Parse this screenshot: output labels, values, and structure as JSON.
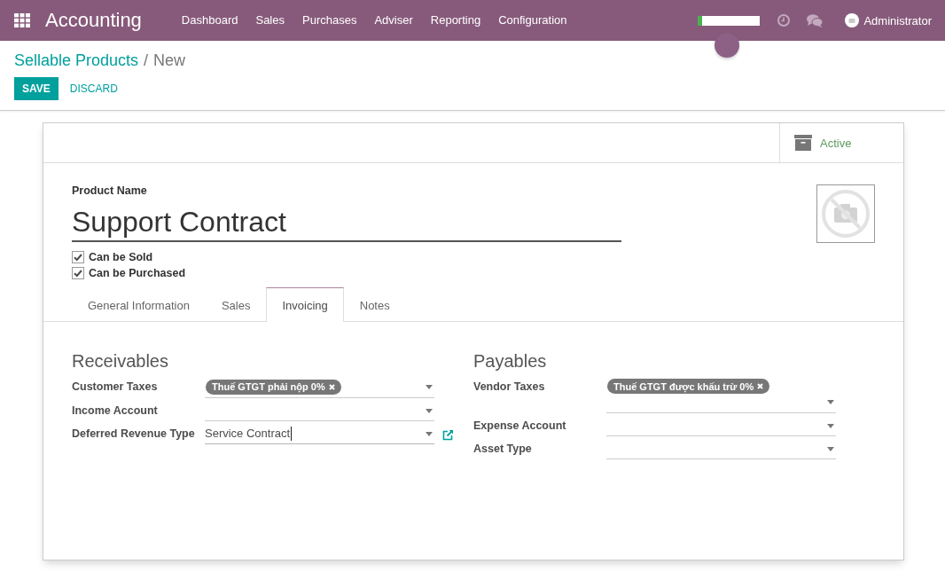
{
  "navbar": {
    "app_title": "Accounting",
    "menu": [
      "Dashboard",
      "Sales",
      "Purchases",
      "Adviser",
      "Reporting",
      "Configuration"
    ],
    "progress": {
      "level": 0.07
    },
    "user": "Administrator"
  },
  "control_panel": {
    "breadcrumb": [
      {
        "label": "Sellable Products",
        "kind": "link"
      },
      {
        "label": "New",
        "kind": "current"
      }
    ],
    "separator": "/",
    "buttons": [
      {
        "label": "SAVE",
        "kind": "primary"
      },
      {
        "label": "DISCARD",
        "kind": "link"
      }
    ]
  },
  "button_box": {
    "label": "Active",
    "on": true
  },
  "product": {
    "name_label": "Product Name",
    "name": "Support Contract",
    "options": [
      {
        "label": "Can be Sold",
        "checked": true
      },
      {
        "label": "Can be Purchased",
        "checked": true
      }
    ]
  },
  "tabs": [
    {
      "label": "General Information",
      "selected": false
    },
    {
      "label": "Sales",
      "selected": false
    },
    {
      "label": "Invoicing",
      "selected": true
    },
    {
      "label": "Notes",
      "selected": false
    }
  ],
  "sections": [
    {
      "title": "Receivables",
      "fields": [
        {
          "label": "Customer Taxes",
          "kind": "tags",
          "tags": [
            "Thuế GTGT phải nộp 0%"
          ],
          "focused": false
        },
        {
          "label": "Income Account",
          "kind": "select",
          "focused": false
        },
        {
          "label": "Deferred Revenue Type",
          "kind": "select",
          "value": "Service Contract",
          "focused": true
        }
      ]
    },
    {
      "title": "Payables",
      "fields": [
        {
          "label": "Vendor Taxes",
          "kind": "tags",
          "tags": [
            "Thuế GTGT được khấu trừ 0%"
          ],
          "focused": false
        },
        {
          "label": "Expense Account",
          "kind": "select",
          "focused": false
        },
        {
          "label": "Asset Type",
          "kind": "select",
          "focused": false
        }
      ]
    }
  ]
}
